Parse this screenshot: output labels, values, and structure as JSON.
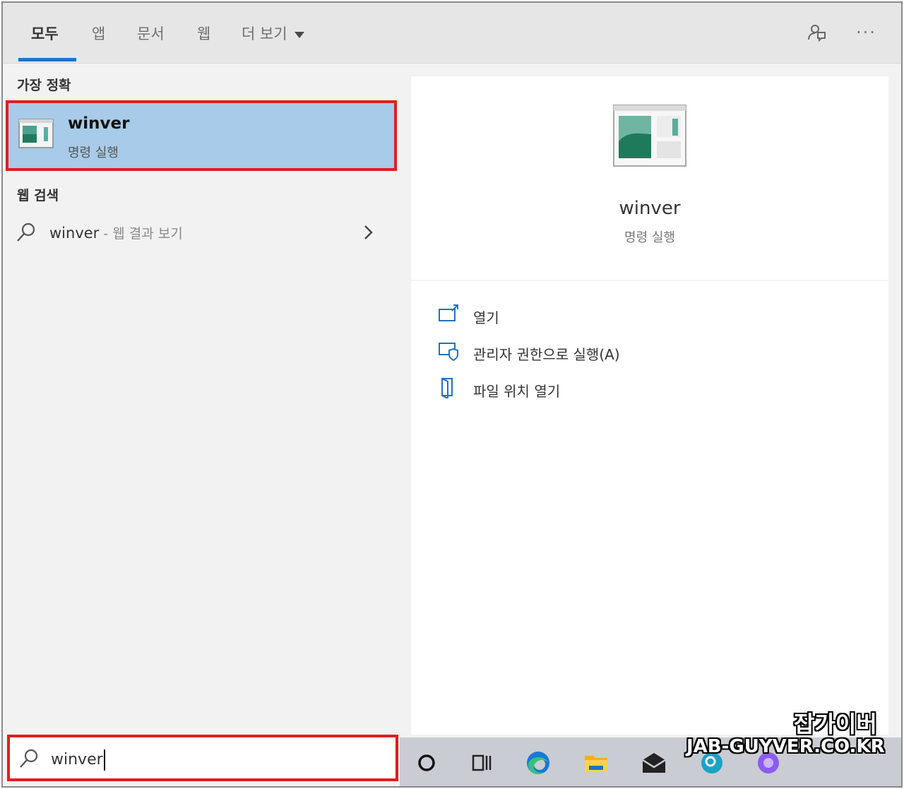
{
  "tabs": {
    "all": "모두",
    "apps": "앱",
    "documents": "문서",
    "web": "웹",
    "more": "더 보기"
  },
  "left": {
    "best_match_heading": "가장 정확",
    "best_match": {
      "title": "winver",
      "subtitle": "명령 실행",
      "icon": "app-window-icon"
    },
    "web_heading": "웹 검색",
    "web_result": {
      "query": "winver",
      "suffix": " - 웹 결과 보기",
      "icon": "search-icon"
    }
  },
  "preview": {
    "title": "winver",
    "subtitle": "명령 실행"
  },
  "actions": [
    {
      "label": "열기",
      "icon": "open-icon"
    },
    {
      "label": "관리자 권한으로 실행(A)",
      "icon": "run-as-admin-icon"
    },
    {
      "label": "파일 위치 열기",
      "icon": "file-location-icon"
    }
  ],
  "search": {
    "value": "winver"
  },
  "taskbar": [
    "cortana-icon",
    "task-view-icon",
    "edge-icon",
    "file-explorer-icon",
    "mail-icon",
    "search-app-icon",
    "app-icon"
  ],
  "watermark": {
    "korean": "잡가이버",
    "english": "JAB-GUYVER.CO.KR"
  },
  "colors": {
    "accent": "#1e73c9",
    "highlight": "#a7cbe8",
    "annotation": "#e01e1e"
  }
}
